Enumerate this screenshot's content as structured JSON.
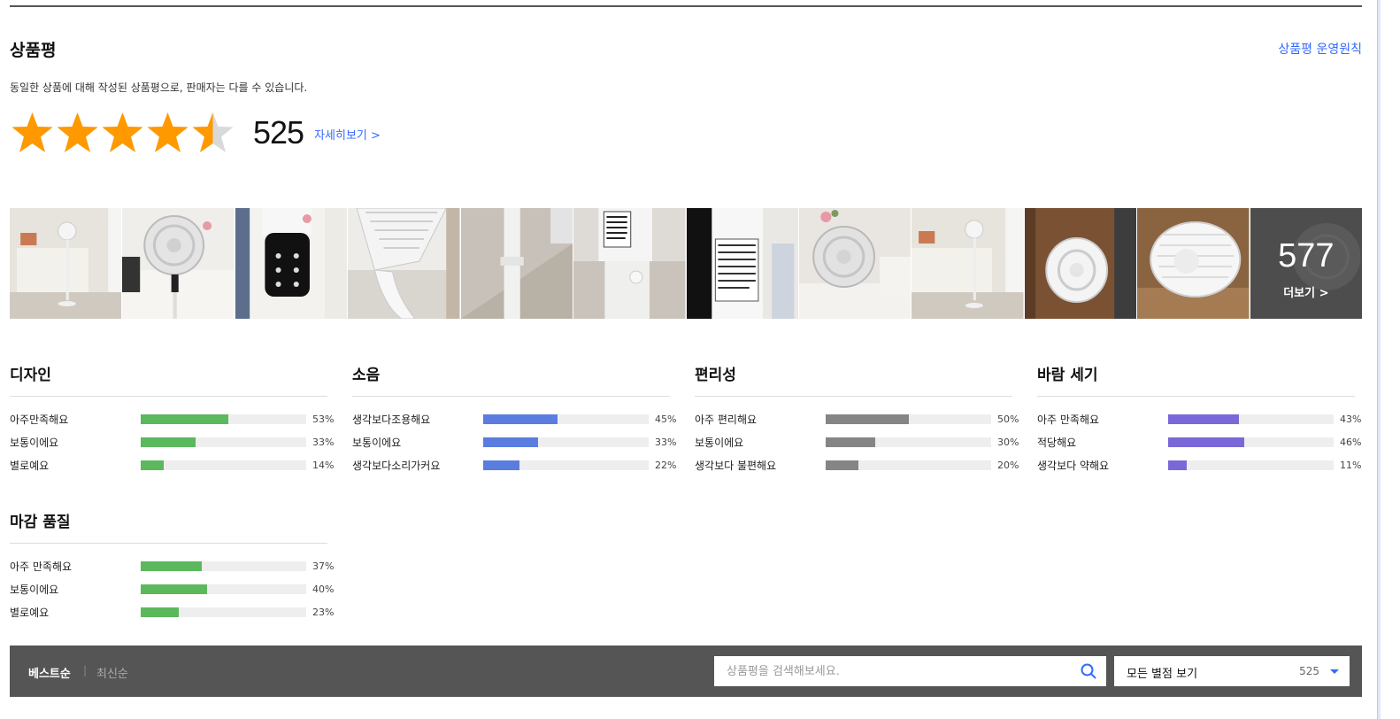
{
  "header": {
    "title": "상품평",
    "policy_link": "상품평 운영원칙",
    "notice": "동일한 상품에 대해 작성된 상품평으로, 판매자는 다를 수 있습니다."
  },
  "rating": {
    "stars": 4.5,
    "max_stars": 5,
    "count": "525",
    "detail_link": "자세히보기 >"
  },
  "photos": {
    "items": [
      "photo-1",
      "photo-2",
      "photo-3",
      "photo-4",
      "photo-5",
      "photo-6",
      "photo-7",
      "photo-8",
      "photo-9",
      "photo-10",
      "photo-11",
      "photo-12"
    ],
    "more_count": "577",
    "more_label": "더보기 >"
  },
  "surveys": [
    {
      "title": "디자인",
      "color": "#5cb85c",
      "rows": [
        {
          "label": "아주만족해요",
          "percent": 53,
          "text": "53%"
        },
        {
          "label": "보통이에요",
          "percent": 33,
          "text": "33%"
        },
        {
          "label": "별로예요",
          "percent": 14,
          "text": "14%"
        }
      ]
    },
    {
      "title": "소음",
      "color": "#5b7ddf",
      "rows": [
        {
          "label": "생각보다조용해요",
          "percent": 45,
          "text": "45%"
        },
        {
          "label": "보통이에요",
          "percent": 33,
          "text": "33%"
        },
        {
          "label": "생각보다소리가커요",
          "percent": 22,
          "text": "22%"
        }
      ]
    },
    {
      "title": "편리성",
      "color": "#858585",
      "rows": [
        {
          "label": "아주 편리해요",
          "percent": 50,
          "text": "50%"
        },
        {
          "label": "보통이에요",
          "percent": 30,
          "text": "30%"
        },
        {
          "label": "생각보다 불편해요",
          "percent": 20,
          "text": "20%"
        }
      ]
    },
    {
      "title": "바람 세기",
      "color": "#7b68d8",
      "rows": [
        {
          "label": "아주 만족해요",
          "percent": 43,
          "text": "43%"
        },
        {
          "label": "적당해요",
          "percent": 46,
          "text": "46%"
        },
        {
          "label": "생각보다 약해요",
          "percent": 11,
          "text": "11%"
        }
      ]
    },
    {
      "title": "마감 품질",
      "color": "#5cb85c",
      "rows": [
        {
          "label": "아주 만족해요",
          "percent": 37,
          "text": "37%"
        },
        {
          "label": "보통이에요",
          "percent": 40,
          "text": "40%"
        },
        {
          "label": "별로예요",
          "percent": 23,
          "text": "23%"
        }
      ]
    }
  ],
  "sort": {
    "best": "베스트순",
    "separator": "|",
    "newest": "최신순"
  },
  "search": {
    "placeholder": "상품평을 검색해보세요."
  },
  "filter": {
    "label": "모든 별점 보기",
    "count": "525"
  },
  "colors": {
    "star": "#ff9900",
    "link": "#346aff",
    "sort_bar": "#555555"
  }
}
